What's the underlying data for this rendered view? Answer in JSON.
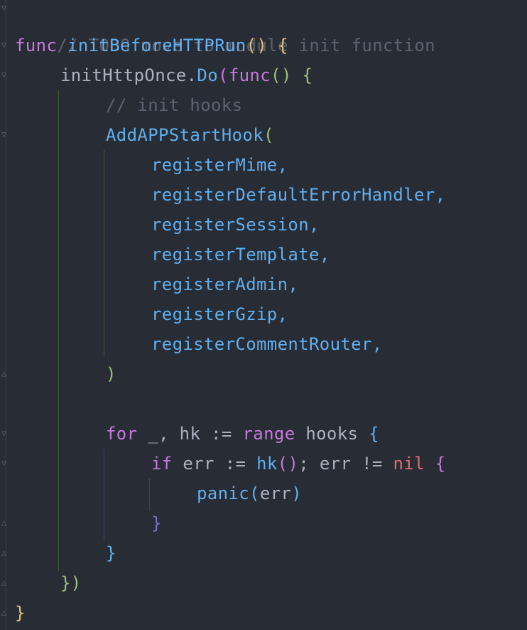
{
  "code": {
    "line1": {
      "comment": "// TODO move to module init function"
    },
    "line2": {
      "kw_func": "func",
      "fn_name": "initBeforeHTTPRun",
      "parens": "()",
      "brace": "{"
    },
    "line3": {
      "ident": "initHttpOnce",
      "dot": ".",
      "method": "Do",
      "lparen": "(",
      "kw_func": "func",
      "parens": "()",
      "brace": "{"
    },
    "line4": {
      "comment": "// init hooks"
    },
    "line5": {
      "fn": "AddAPPStartHook",
      "lparen": "("
    },
    "args": [
      "registerMime,",
      "registerDefaultErrorHandler,",
      "registerSession,",
      "registerTemplate,",
      "registerAdmin,",
      "registerGzip,",
      "registerCommentRouter,"
    ],
    "line13": {
      "rparen": ")"
    },
    "line15": {
      "kw_for": "for",
      "blank": "_",
      "comma": ",",
      "hk": "hk",
      "assign": ":=",
      "kw_range": "range",
      "hooks": "hooks",
      "brace": "{"
    },
    "line16": {
      "kw_if": "if",
      "err": "err",
      "assign": ":=",
      "call_hk": "hk",
      "parens": "()",
      "semi": ";",
      "err2": "err",
      "neq": "!=",
      "nil": "nil",
      "brace": "{"
    },
    "line17": {
      "panic": "panic",
      "lparen": "(",
      "err": "err",
      "rparen": ")"
    },
    "line18": {
      "brace": "}"
    },
    "line19": {
      "brace": "}"
    },
    "line20": {
      "brace_paren": "})"
    },
    "line21": {
      "brace": "}"
    }
  },
  "colors": {
    "background": "#282c34",
    "comment": "#5c6370",
    "keyword": "#c678dd",
    "function": "#61afef",
    "identifier": "#abb2bf",
    "nil": "#e06c75",
    "brace_yellow": "#e5c07b",
    "brace_green": "#98c379"
  }
}
